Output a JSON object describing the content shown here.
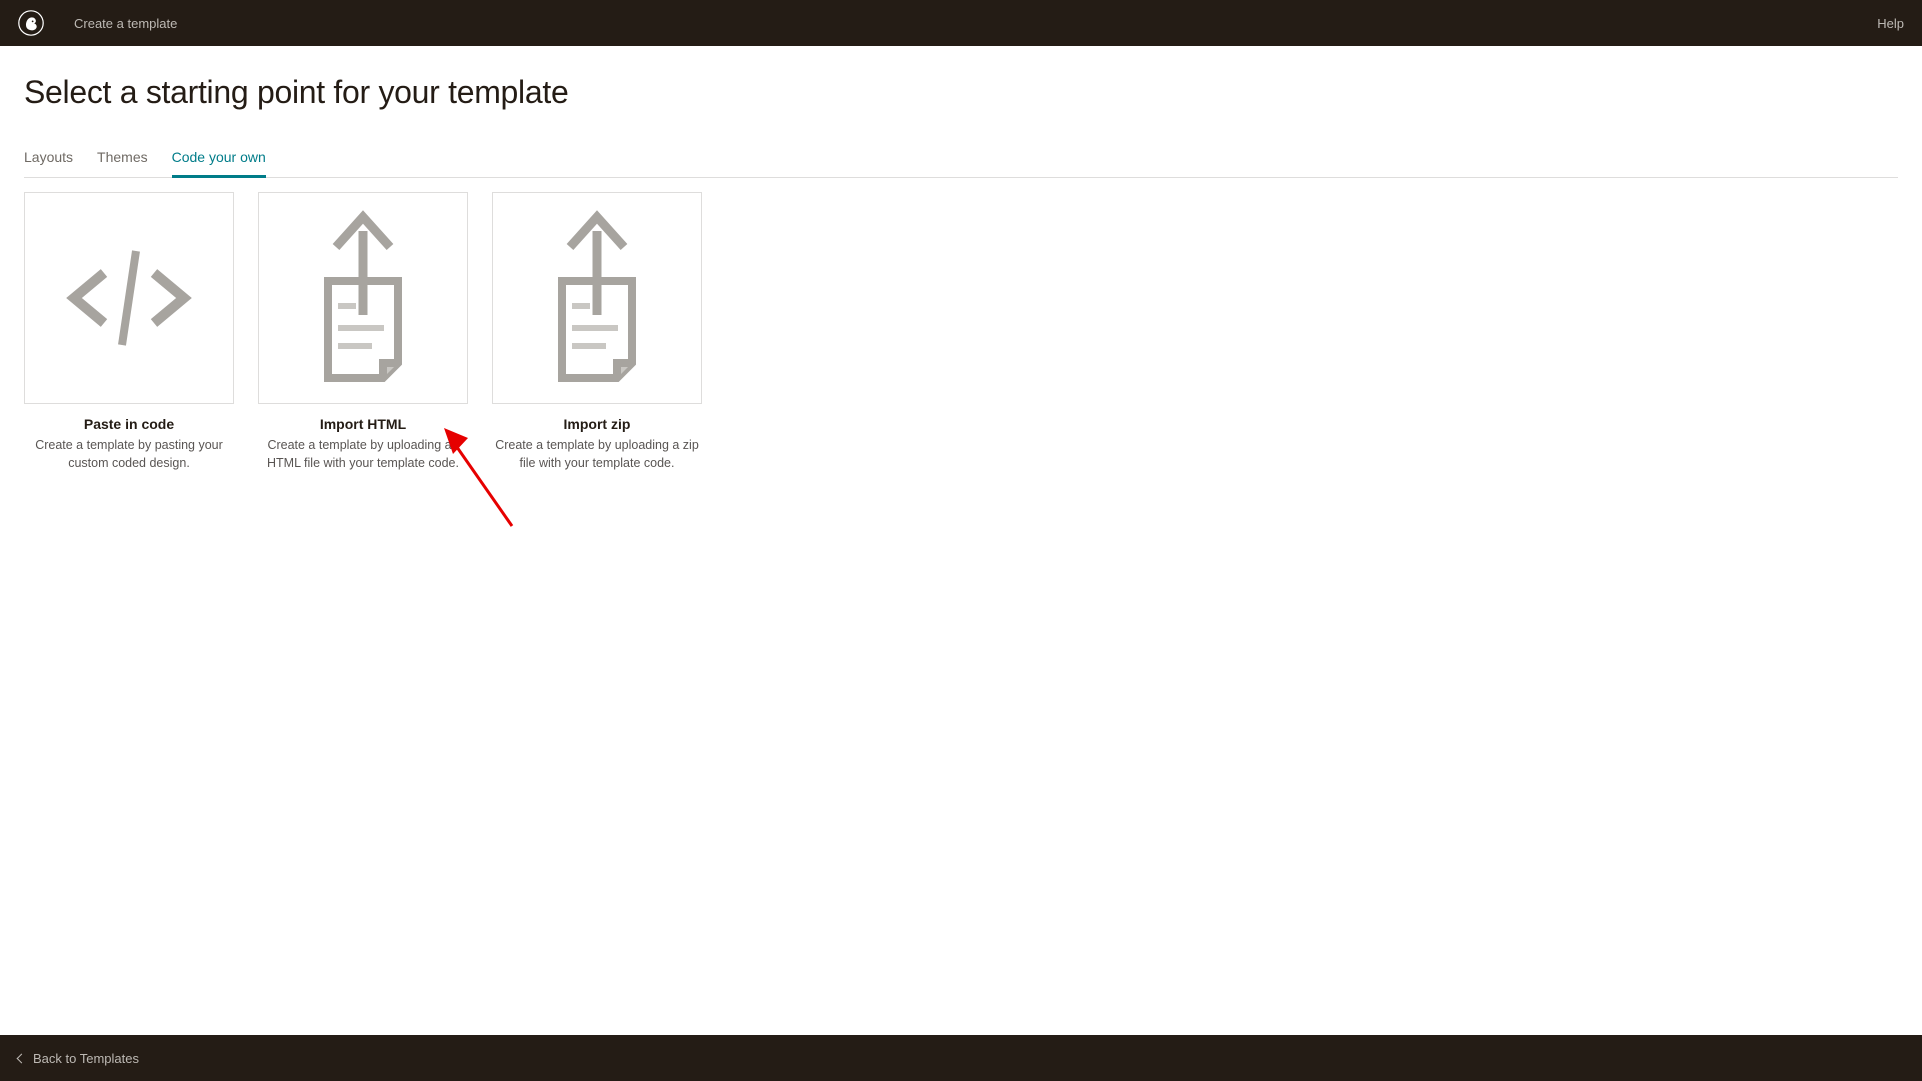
{
  "header": {
    "breadcrumb": "Create a template",
    "help_label": "Help"
  },
  "page": {
    "title": "Select a starting point for your template"
  },
  "tabs": [
    {
      "label": "Layouts",
      "active": false
    },
    {
      "label": "Themes",
      "active": false
    },
    {
      "label": "Code your own",
      "active": true
    }
  ],
  "cards": [
    {
      "title": "Paste in code",
      "desc": "Create a template by pasting your custom coded design.",
      "icon": "code-icon"
    },
    {
      "title": "Import HTML",
      "desc": "Create a template by uploading an HTML file with your template code.",
      "icon": "upload-doc-icon"
    },
    {
      "title": "Import zip",
      "desc": "Create a template by uploading a zip file with your template code.",
      "icon": "upload-doc-icon"
    }
  ],
  "footer": {
    "back_label": "Back to Templates"
  }
}
